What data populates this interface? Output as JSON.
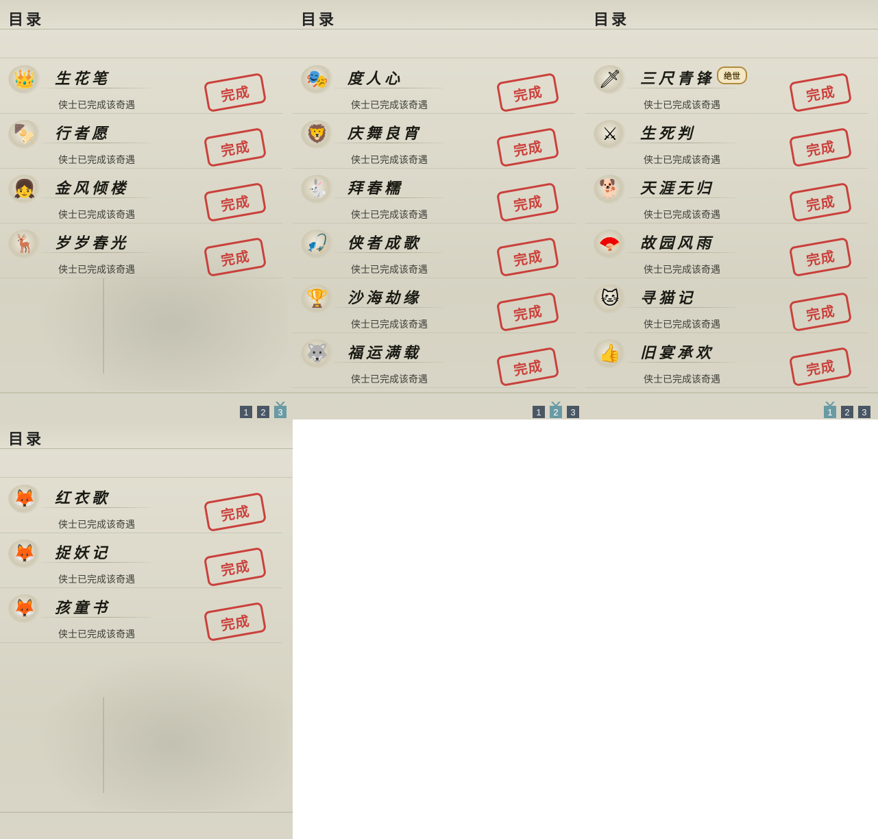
{
  "panels": [
    {
      "title": "目录",
      "items": [
        {
          "icon": "crown-icon",
          "glyph": "👑",
          "name": "生花笔",
          "status": "侠士已完成该奇遇",
          "stamp": "完成"
        },
        {
          "icon": "skewer-icon",
          "glyph": "🍢",
          "name": "行者愿",
          "status": "侠士已完成该奇遇",
          "stamp": "完成"
        },
        {
          "icon": "girl-icon",
          "glyph": "👧",
          "name": "金风倾楼",
          "status": "侠士已完成该奇遇",
          "stamp": "完成"
        },
        {
          "icon": "deer-toy-icon",
          "glyph": "🦌",
          "name": "岁岁春光",
          "status": "侠士已完成该奇遇",
          "stamp": "完成"
        }
      ],
      "pages": [
        "1",
        "2",
        "3"
      ],
      "current_page": "3"
    },
    {
      "title": "目录",
      "items": [
        {
          "icon": "mask-icon",
          "glyph": "🎭",
          "name": "度人心",
          "status": "侠士已完成该奇遇",
          "stamp": "完成"
        },
        {
          "icon": "lion-dance-icon",
          "glyph": "🦁",
          "name": "庆舞良宵",
          "status": "侠士已完成该奇遇",
          "stamp": "完成"
        },
        {
          "icon": "rabbit-icon",
          "glyph": "🐇",
          "name": "拜春糯",
          "status": "侠士已完成该奇遇",
          "stamp": "完成"
        },
        {
          "icon": "fishing-rod-icon",
          "glyph": "🎣",
          "name": "侠者成歌",
          "status": "侠士已完成该奇遇",
          "stamp": "完成"
        },
        {
          "icon": "goblet-icon",
          "glyph": "🏆",
          "name": "沙海劫缘",
          "status": "侠士已完成该奇遇",
          "stamp": "完成"
        },
        {
          "icon": "husky-icon",
          "glyph": "🐺",
          "name": "福运满载",
          "status": "侠士已完成该奇遇",
          "stamp": "完成"
        }
      ],
      "pages": [
        "1",
        "2",
        "3"
      ],
      "current_page": "2"
    },
    {
      "title": "目录",
      "items": [
        {
          "icon": "sword-icon",
          "glyph": "🗡",
          "name": "三尺青锋",
          "status": "侠士已完成该奇遇",
          "stamp": "完成",
          "badge": "绝世"
        },
        {
          "icon": "blade-icon",
          "glyph": "⚔",
          "name": "生死判",
          "status": "侠士已完成该奇遇",
          "stamp": "完成"
        },
        {
          "icon": "dog-icon",
          "glyph": "🐕",
          "name": "天涯无归",
          "status": "侠士已完成该奇遇",
          "stamp": "完成"
        },
        {
          "icon": "fan-icon",
          "glyph": "🪭",
          "name": "故园风雨",
          "status": "侠士已完成该奇遇",
          "stamp": "完成"
        },
        {
          "icon": "cat-icon",
          "glyph": "🐱",
          "name": "寻猫记",
          "status": "侠士已完成该奇遇",
          "stamp": "完成"
        },
        {
          "icon": "thumbs-up-icon",
          "glyph": "👍",
          "name": "旧宴承欢",
          "status": "侠士已完成该奇遇",
          "stamp": "完成"
        }
      ],
      "pages": [
        "1",
        "2",
        "3"
      ],
      "current_page": "1"
    },
    {
      "title": "目录",
      "items": [
        {
          "icon": "fox-icon",
          "glyph": "🦊",
          "name": "红衣歌",
          "status": "侠士已完成该奇遇",
          "stamp": "完成"
        },
        {
          "icon": "fox-icon",
          "glyph": "🦊",
          "name": "捉妖记",
          "status": "侠士已完成该奇遇",
          "stamp": "完成"
        },
        {
          "icon": "fox-icon",
          "glyph": "🦊",
          "name": "孩童书",
          "status": "侠士已完成该奇遇",
          "stamp": "完成"
        }
      ]
    }
  ]
}
